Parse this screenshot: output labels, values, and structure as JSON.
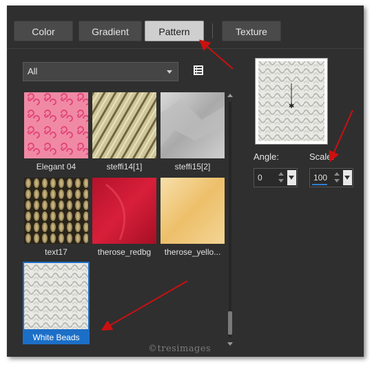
{
  "tabs": [
    {
      "label": "Color",
      "active": false
    },
    {
      "label": "Gradient",
      "active": false
    },
    {
      "label": "Pattern",
      "active": true
    },
    {
      "label": "Texture",
      "active": false
    }
  ],
  "category_dropdown": {
    "value": "All"
  },
  "patterns": [
    {
      "label": "Elegant 04",
      "selected": false
    },
    {
      "label": "steffi14[1]",
      "selected": false
    },
    {
      "label": "steffi15[2]",
      "selected": false
    },
    {
      "label": "text17",
      "selected": false
    },
    {
      "label": "therose_redbg",
      "selected": false
    },
    {
      "label": "therose_yello...",
      "selected": false
    },
    {
      "label": "White Beads",
      "selected": true
    }
  ],
  "angle": {
    "label": "Angle:",
    "value": "0"
  },
  "scale": {
    "label": "Scale:",
    "value": "100"
  },
  "watermark": "©tresimages",
  "colors": {
    "accent": "#1c6fc7",
    "panel": "#2f2f2f",
    "arrow": "#cc1010"
  },
  "icons": [
    "list-view-icon",
    "dropdown-caret-icon",
    "scroll-up-icon",
    "scroll-down-icon",
    "spinner-up-icon",
    "spinner-down-icon"
  ]
}
